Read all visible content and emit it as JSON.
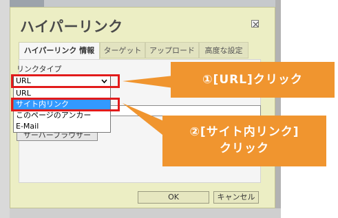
{
  "dialog": {
    "title": "ハイパーリンク",
    "close_icon": "close-x-icon"
  },
  "tabs": [
    {
      "label": "ハイパーリンク 情報",
      "active": true
    },
    {
      "label": "ターゲット",
      "active": false
    },
    {
      "label": "アップロード",
      "active": false
    },
    {
      "label": "高度な設定",
      "active": false
    }
  ],
  "link_type": {
    "label": "リンクタイプ",
    "selected": "URL",
    "options": [
      "URL",
      "サイト内リンク",
      "このページのアンカー",
      "E-Mail"
    ],
    "highlighted_option": "サイト内リンク"
  },
  "browse_button": {
    "label": "サーバーブラウザー"
  },
  "footer": {
    "ok_label": "OK",
    "cancel_label": "キャンセル"
  },
  "annotations": {
    "callout1": "①[URL]クリック",
    "callout2_line1": "②[サイト内リンク]",
    "callout2_line2": "クリック"
  },
  "colors": {
    "dialog_bg": "#eceec4",
    "highlight": "#e21b1b",
    "callout": "#f0952f",
    "selection": "#3399ff"
  }
}
